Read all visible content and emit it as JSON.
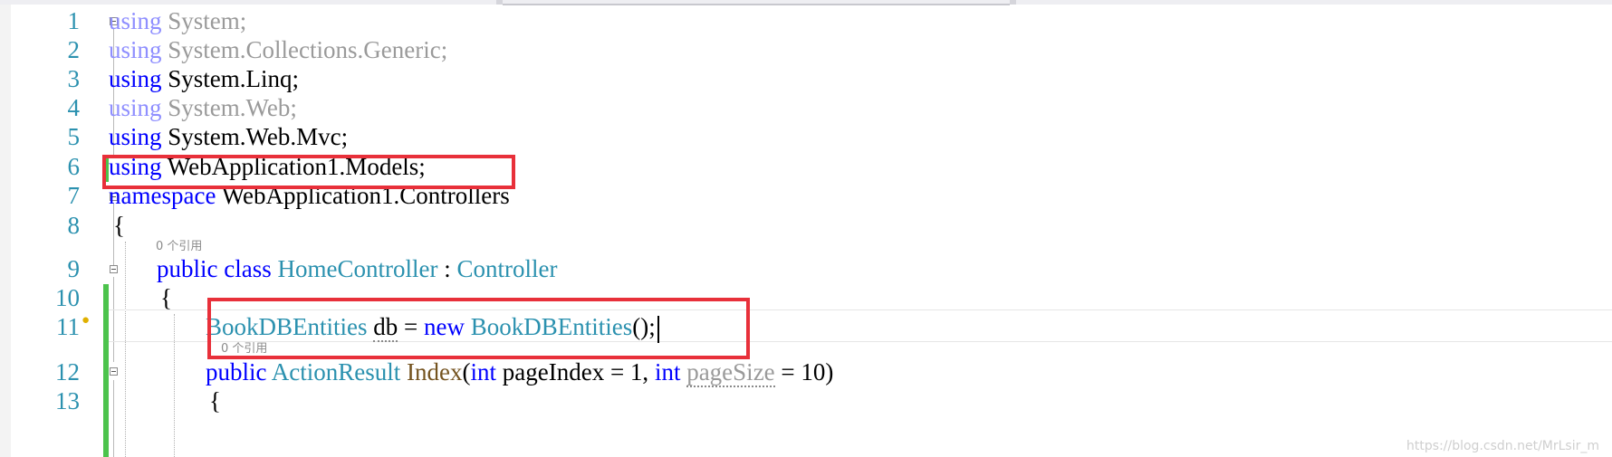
{
  "editor": {
    "lines": [
      {
        "number": "1",
        "tokens": [
          "using",
          " System;"
        ]
      },
      {
        "number": "2",
        "tokens": [
          "using",
          " System.Collections.Generic;"
        ]
      },
      {
        "number": "3",
        "tokens": [
          "using",
          " System.Linq;"
        ]
      },
      {
        "number": "4",
        "tokens": [
          "using",
          " System.Web;"
        ]
      },
      {
        "number": "5",
        "tokens": [
          "using",
          " System.Web.Mvc;"
        ]
      },
      {
        "number": "6",
        "tokens": [
          "using",
          " WebApplication1.Models;"
        ]
      },
      {
        "number": "7",
        "tokens": [
          "namespace",
          " WebApplication1.Controllers"
        ]
      },
      {
        "number": "8",
        "tokens": [
          "{"
        ]
      },
      {
        "number": "9",
        "tokens": [
          "public",
          " ",
          "class",
          " ",
          "HomeController",
          " : ",
          "Controller"
        ]
      },
      {
        "number": "10",
        "tokens": [
          "{"
        ]
      },
      {
        "number": "11",
        "tokens": [
          "BookDBEntities",
          " ",
          "db",
          " = ",
          "new",
          " ",
          "BookDBEntities",
          "();"
        ]
      },
      {
        "number": "12",
        "tokens": [
          "public",
          " ",
          "ActionResult",
          " ",
          "Index",
          "(",
          "int",
          " pageIndex = 1, ",
          "int",
          " ",
          "pageSize",
          " = 10)"
        ]
      },
      {
        "number": "13",
        "tokens": [
          "{"
        ]
      }
    ],
    "codelens": {
      "class_refs": "0 个引用",
      "method_refs": "0 个引用"
    },
    "colors": {
      "keyword": "#0000ff",
      "type": "#2b91af",
      "method": "#74531f",
      "line_number": "#2b91af",
      "unused": "#9a9a9a",
      "change_marker": "#4cc34c",
      "highlight_box": "#e8303a"
    },
    "icons": [
      "fold-collapse-icon",
      "lightbulb-icon"
    ]
  },
  "watermark": "https://blog.csdn.net/MrLsir_m"
}
